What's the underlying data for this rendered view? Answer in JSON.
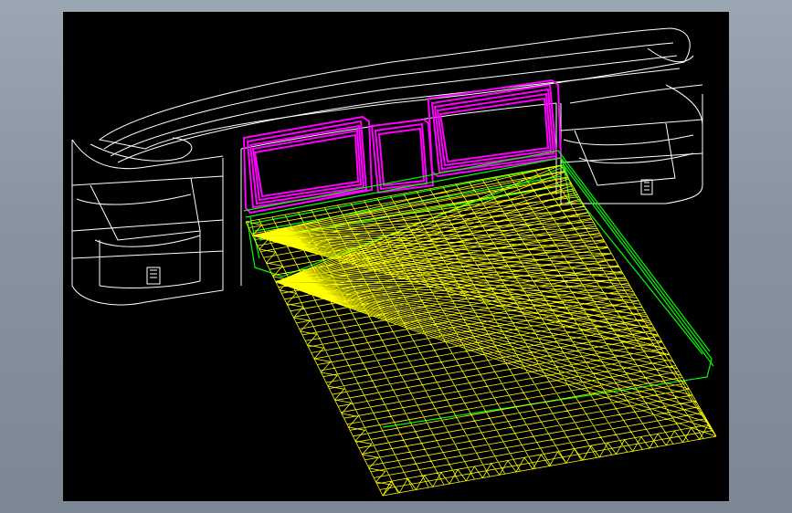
{
  "viewport": {
    "background": "#000000",
    "layers": {
      "headboard": {
        "color": "#ffffff"
      },
      "pillows": {
        "color": "#ff00ff"
      },
      "bed_frame": {
        "color": "#00ff00"
      },
      "mattress_cover": {
        "color": "#ffff00"
      }
    }
  },
  "frame": {
    "background": "#8a96a3"
  }
}
